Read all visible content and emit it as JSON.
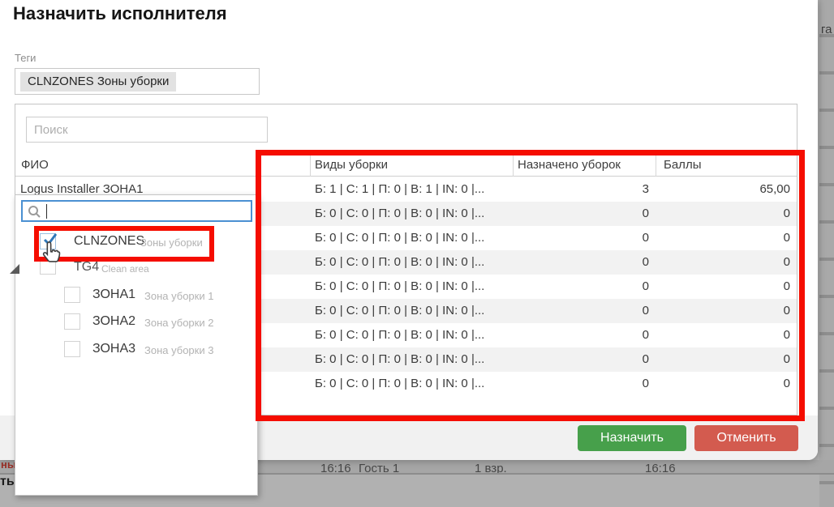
{
  "dialog": {
    "title": "Назначить исполнителя",
    "tags_label": "Теги",
    "tag_chip": "CLNZONES Зоны уборки",
    "assign_button": "Назначить",
    "cancel_button": "Отменить"
  },
  "people_panel": {
    "search_placeholder": "Поиск",
    "columns": [
      "ФИО",
      "Виды уборки",
      "Назначено уборок",
      "Баллы"
    ]
  },
  "table_rows": [
    {
      "fio": "Logus Installer ЗОНА1",
      "cleaning_types": "Б: 1 | С: 1 | П: 0 | В: 1 | IN: 0 |...",
      "assigned": "3",
      "points": "65,00"
    },
    {
      "fio": "",
      "cleaning_types": "Б: 0 | С: 0 | П: 0 | В: 0 | IN: 0 |...",
      "assigned": "0",
      "points": "0"
    },
    {
      "fio": "",
      "cleaning_types": "Б: 0 | С: 0 | П: 0 | В: 0 | IN: 0 |...",
      "assigned": "0",
      "points": "0"
    },
    {
      "fio": "",
      "cleaning_types": "Б: 0 | С: 0 | П: 0 | В: 0 | IN: 0 |...",
      "assigned": "0",
      "points": "0"
    },
    {
      "fio": "",
      "cleaning_types": "Б: 0 | С: 0 | П: 0 | В: 0 | IN: 0 |...",
      "assigned": "0",
      "points": "0"
    },
    {
      "fio": "",
      "cleaning_types": "Б: 0 | С: 0 | П: 0 | В: 0 | IN: 0 |...",
      "assigned": "0",
      "points": "0"
    },
    {
      "fio": "",
      "cleaning_types": "Б: 0 | С: 0 | П: 0 | В: 0 | IN: 0 |...",
      "assigned": "0",
      "points": "0"
    },
    {
      "fio": "",
      "cleaning_types": "Б: 0 | С: 0 | П: 0 | В: 0 | IN: 0 |...",
      "assigned": "0",
      "points": "0"
    },
    {
      "fio": "",
      "cleaning_types": "Б: 0 | С: 0 | П: 0 | В: 0 | IN: 0 |...",
      "assigned": "0",
      "points": "0"
    }
  ],
  "tag_dropdown": {
    "search_value": "",
    "items": [
      {
        "code": "CLNZONES",
        "label": "Зоны уборки",
        "checked": true,
        "level": 0
      },
      {
        "code": "TG4",
        "label": "Clean area",
        "checked": false,
        "level": 0,
        "expanded": true
      },
      {
        "code": "ЗОНА1",
        "label": "Зона уборки 1",
        "checked": false,
        "level": 1
      },
      {
        "code": "ЗОНА2",
        "label": "Зона уборки 2",
        "checked": false,
        "level": 1
      },
      {
        "code": "ЗОНА3",
        "label": "Зона уборки 3",
        "checked": false,
        "level": 1
      }
    ]
  },
  "background": {
    "right_fragment": "га",
    "left_red_fragment": "ны",
    "left_bold_fragment": "ть",
    "bottom_row": {
      "time_in": "16:16",
      "guest": "Гость 1",
      "pax": "1 взр.",
      "time_out": "16:16"
    }
  },
  "colors": {
    "annotation_red": "#f50d00",
    "assign_green": "#47a04b",
    "cancel_red": "#d35b4f",
    "focus_blue": "#4a90d2",
    "check_blue": "#2f77b8"
  }
}
